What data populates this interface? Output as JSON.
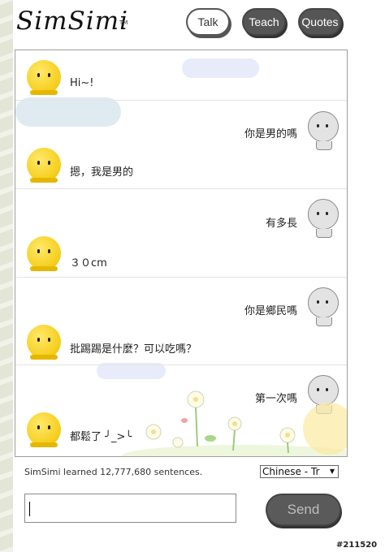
{
  "header": {
    "logo": "SimSimi",
    "tm": "TM",
    "nav": [
      {
        "label": "Talk",
        "active": true
      },
      {
        "label": "Teach",
        "active": false
      },
      {
        "label": "Quotes",
        "active": false
      }
    ]
  },
  "chat": {
    "messages": [
      {
        "from": "simsimi",
        "text": "Hi~!"
      },
      {
        "from": "user",
        "text": "你是男的嗎"
      },
      {
        "from": "simsimi",
        "text": "摁，我是男的"
      },
      {
        "from": "user",
        "text": "有多長"
      },
      {
        "from": "simsimi",
        "text": "３０cm"
      },
      {
        "from": "user",
        "text": "你是鄉民嗎"
      },
      {
        "from": "simsimi",
        "text": "批踢踢是什麼？可以吃嗎？"
      },
      {
        "from": "user",
        "text": "第一次嗎"
      },
      {
        "from": "simsimi",
        "text": "都鬆了 ╯_>╰"
      }
    ]
  },
  "footer": {
    "learned_text": "SimSimi learned 12,777,680 sentences.",
    "language_selected": "Chinese - Tr",
    "input_value": "",
    "send_label": "Send",
    "watermark": "#211520"
  },
  "colors": {
    "simsimi_yellow": "#f5cd1a",
    "button_dark": "#555555",
    "cloud": "#e6e9fa"
  },
  "icons": {
    "simsimi_avatar": "simsimi-avatar-icon",
    "user_avatar": "user-avatar-icon",
    "dropdown": "chevron-down-icon"
  }
}
